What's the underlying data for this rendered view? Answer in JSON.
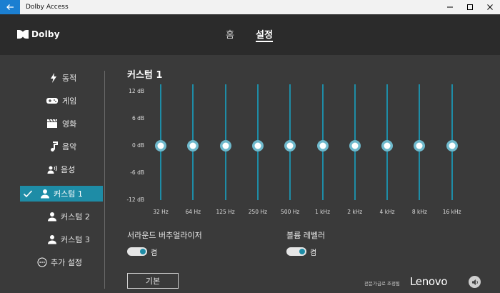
{
  "window": {
    "title": "Dolby Access"
  },
  "header": {
    "brand": "Dolby",
    "tabs": [
      {
        "label": "홈"
      },
      {
        "label": "설정"
      }
    ]
  },
  "sidebar": {
    "items": [
      {
        "label": "동적",
        "icon": "lightning-icon"
      },
      {
        "label": "게임",
        "icon": "gamepad-icon"
      },
      {
        "label": "영화",
        "icon": "clapperboard-icon"
      },
      {
        "label": "음악",
        "icon": "music-note-icon"
      },
      {
        "label": "음성",
        "icon": "voice-icon"
      },
      {
        "label": "커스텀 1",
        "icon": "person-icon",
        "active": true
      },
      {
        "label": "커스텀 2",
        "icon": "person-icon"
      },
      {
        "label": "커스텀 3",
        "icon": "person-icon"
      },
      {
        "label": "추가 설정",
        "icon": "more-icon"
      }
    ]
  },
  "main": {
    "title": "커스텀 1",
    "equalizer": {
      "db_labels": [
        "12 dB",
        "6 dB",
        "0 dB",
        "-6 dB",
        "-12 dB"
      ],
      "bands": [
        {
          "freq": "32 Hz",
          "gain_db": 0
        },
        {
          "freq": "64 Hz",
          "gain_db": 0
        },
        {
          "freq": "125 Hz",
          "gain_db": 0
        },
        {
          "freq": "250 Hz",
          "gain_db": 0
        },
        {
          "freq": "500 Hz",
          "gain_db": 0
        },
        {
          "freq": "1 kHz",
          "gain_db": 0
        },
        {
          "freq": "2 kHz",
          "gain_db": 0
        },
        {
          "freq": "4 kHz",
          "gain_db": 0
        },
        {
          "freq": "8 kHz",
          "gain_db": 0
        },
        {
          "freq": "16 kHz",
          "gain_db": 0
        }
      ],
      "range": [
        -12,
        12
      ]
    },
    "surround": {
      "label": "서라운드 버추얼라이저",
      "state": "켬",
      "on": true
    },
    "volume_leveler": {
      "label": "볼륨 레벨러",
      "state": "켬",
      "on": true
    },
    "default_button": "기본"
  },
  "footer": {
    "note": "전문가급로 조정됨",
    "brand": "Lenovo"
  },
  "colors": {
    "accent": "#1e8ca6",
    "titlebar_back": "#1b7fd1",
    "background": "#3a3a3a",
    "header": "#2b2b2b"
  }
}
